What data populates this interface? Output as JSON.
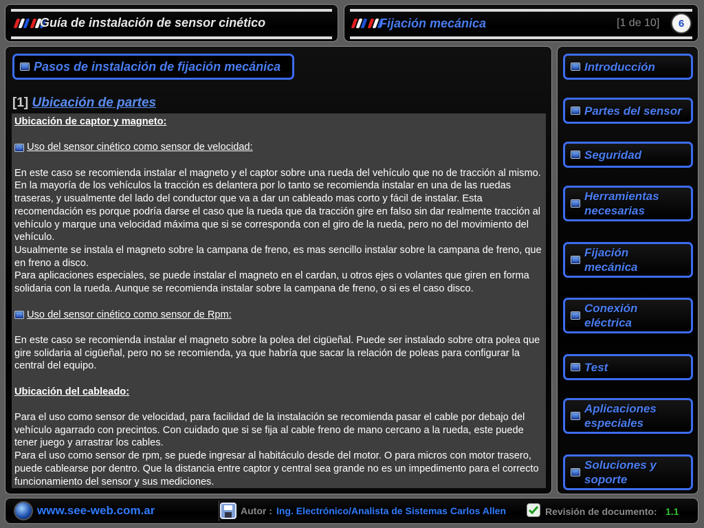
{
  "header": {
    "app_title": "Guía de instalación de sensor cinético",
    "section_title": "Fijación mecánica",
    "counter": "[1 de 10]",
    "page_number": "6"
  },
  "main": {
    "section_heading": "Pasos de instalación de fijación mecánica",
    "step_number": "[1]",
    "step_link": "Ubicación de partes",
    "content": {
      "heading1": "Ubicación de captor y magneto:",
      "sub1": "Uso del sensor cinético como sensor de velocidad:",
      "para1": "En este caso se recomienda instalar el magneto y el captor sobre una rueda del vehículo que no de tracción al mismo. En la mayoría de los vehículos la tracción es delantera por lo tanto se recomienda instalar en una de las ruedas traseras, y usualmente del lado del conductor que va a dar un cableado mas corto y fácil de instalar. Esta recomendación es porque podría darse el caso que la rueda que da tracción gire en falso sin dar realmente tracción al vehículo y marque una velocidad máxima que si se corresponda con el giro de la rueda, pero no del movimiento del vehículo.",
      "para2": "Usualmente se instala el magneto sobre la campana de freno, es mas sencillo instalar sobre la campana de freno, que en freno a disco.",
      "para3": "Para aplicaciones especiales, se puede instalar el magneto en el cardan, u otros ejes o volantes que giren en forma solidaria con la rueda. Aunque se recomienda instalar sobre la campana de freno, o si es el caso disco.",
      "sub2": "Uso del sensor cinético como sensor de Rpm:",
      "para4": "En este caso se recomienda instalar el magneto sobre la polea del cigüeñal. Puede ser instalado sobre otra polea que gire solidaria al cigüeñal, pero no se recomienda, ya que habría que sacar la relación de poleas para configurar la central del equipo.",
      "heading2": "Ubicación del cableado:",
      "para5": "Para el uso como sensor de velocidad, para facilidad de la instalación se recomienda pasar el cable por debajo del vehículo agarrado con precintos. Con cuidado que si se fija al cable freno de mano cercano a la rueda, este puede tener juego y arrastrar los cables.",
      "para6": "Para el uso como sensor de rpm, se puede ingresar al habitáculo desde del motor. O para micros con motor trasero, puede cablearse por dentro.  Que la distancia entre captor y central sea grande no es un impedimento para el correcto funcionamiento del sensor y sus mediciones."
    }
  },
  "sidebar": {
    "items": [
      {
        "label": "Introducción"
      },
      {
        "label": "Partes del sensor"
      },
      {
        "label": "Seguridad"
      },
      {
        "label": "Herramientas necesarias"
      },
      {
        "label": "Fijación mecánica"
      },
      {
        "label": "Conexión eléctrica"
      },
      {
        "label": "Test"
      },
      {
        "label": "Aplicaciones especiales"
      },
      {
        "label": "Soluciones y soporte"
      }
    ]
  },
  "footer": {
    "website": "www.see-web.com.ar",
    "author_label": "Autor :",
    "author_name": "Ing. Electrónico/Analista de Sistemas Carlos Allen",
    "revision_label": "Revisión de documento:",
    "revision_value": "1.1"
  },
  "colors": {
    "accent_blue": "#3d6df0",
    "revision_green": "#2ec42e"
  },
  "icons": [
    "flag-stripes-icon",
    "bullet-square-icon",
    "globe-icon",
    "save-disk-icon",
    "checkmark-icon"
  ]
}
